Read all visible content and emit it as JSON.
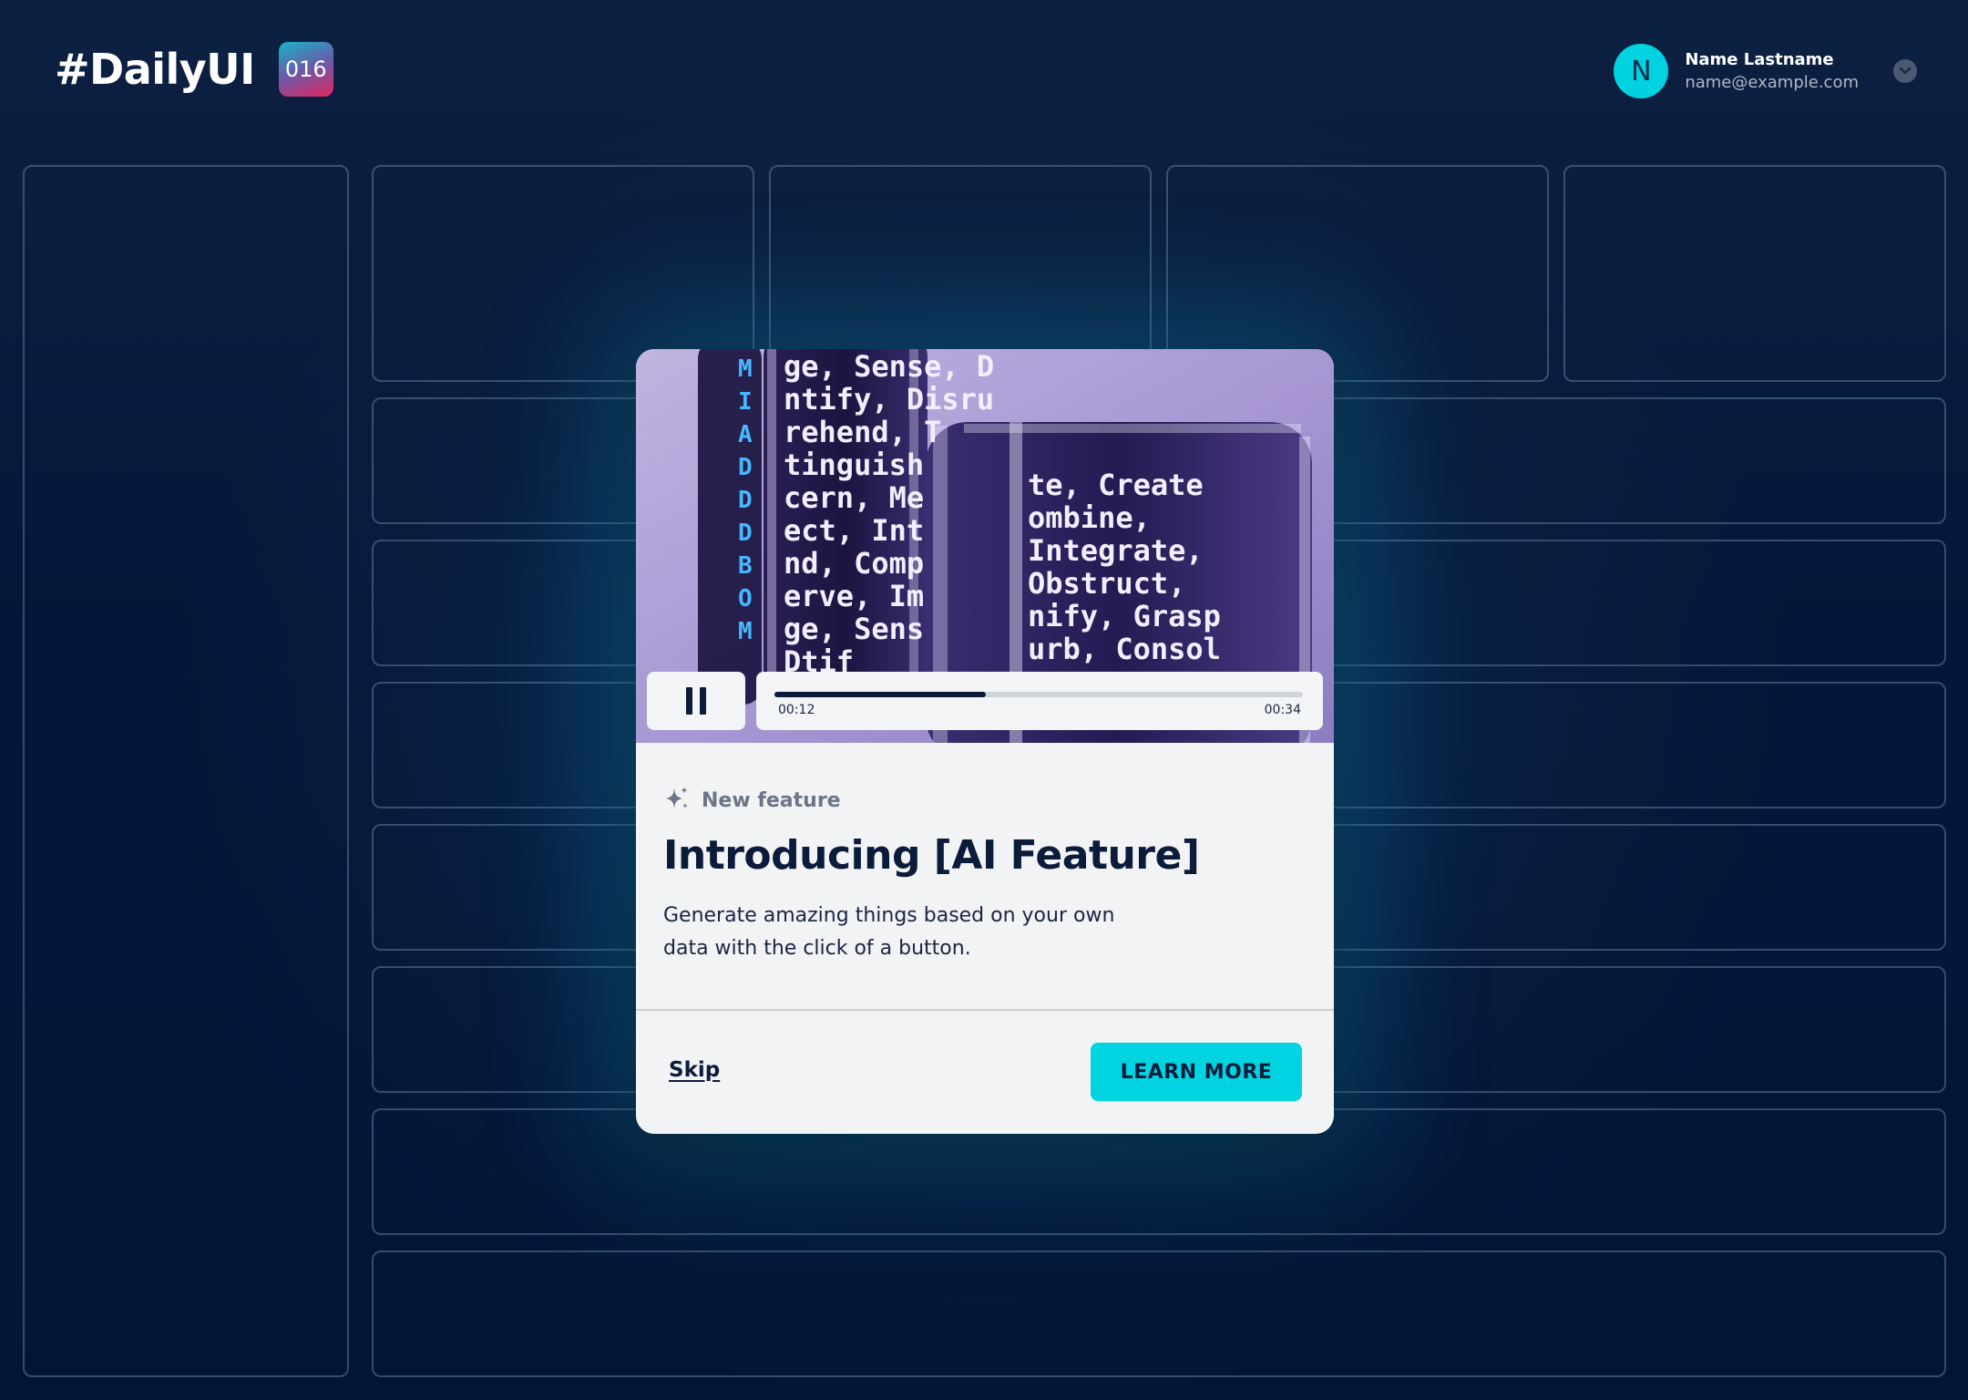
{
  "header": {
    "brand_title": "#DailyUI",
    "badge": "016"
  },
  "user": {
    "initial": "N",
    "name": "Name Lastname",
    "email": "name@example.com"
  },
  "modal": {
    "player": {
      "current_time": "00:12",
      "total_time": "00:34",
      "progress": 0.4
    },
    "tag": "New feature",
    "title": "Introducing [AI Feature]",
    "description": "Generate amazing things based on your own data with the click of a button.",
    "skip_label": "Skip",
    "cta_label": "LEARN MORE"
  },
  "media_text": {
    "left_block": [
      "ge, Sense, D",
      "ntify, Disru",
      "rehend, T",
      "tinguish",
      "cern, Me",
      "ect, Int",
      "nd, Comp",
      "erve, Im",
      "ge, Sens",
      "Dtif"
    ],
    "right_block": [
      "te, Create",
      "ombine,",
      "Integrate,",
      "Obstruct,",
      "nify, Grasp",
      "urb, Consol"
    ],
    "side_chars": [
      "M",
      "I",
      "A",
      "D",
      "D",
      "D",
      "B",
      "O",
      "M"
    ]
  },
  "colors": {
    "accent": "#00d4e0",
    "navy": "#0b1b3a",
    "badge_gradient": [
      "#19b3c8",
      "#e3275e"
    ]
  },
  "icons": {
    "tag_icon": "sparkle-icon",
    "chevron": "chevron-down-icon",
    "pause": "pause-icon"
  }
}
